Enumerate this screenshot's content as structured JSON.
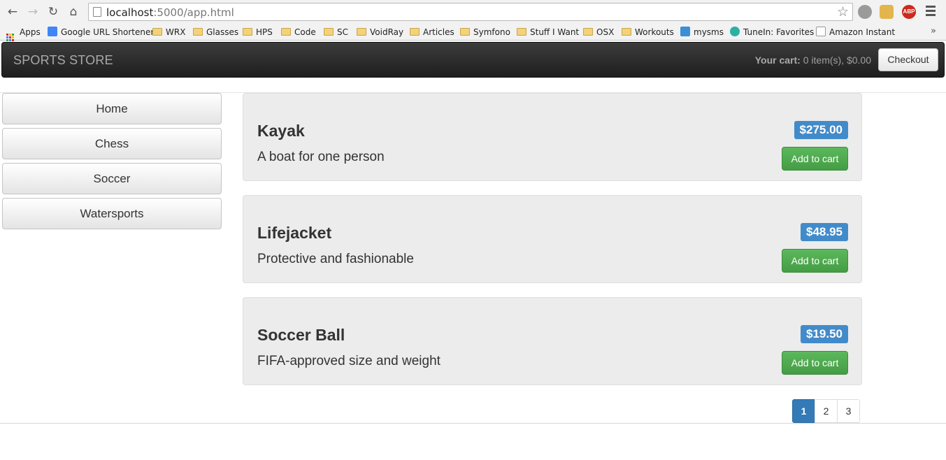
{
  "browser": {
    "url_host": "localhost",
    "url_rest": ":5000/app.html",
    "extensions": [
      "ABP"
    ]
  },
  "bookmarks": [
    {
      "label": "Apps",
      "icon": "apps-icon"
    },
    {
      "label": "Google URL Shortener",
      "icon": "google-icon"
    },
    {
      "label": "WRX",
      "icon": "folder-icon"
    },
    {
      "label": "Glasses",
      "icon": "folder-icon"
    },
    {
      "label": "HPS",
      "icon": "folder-icon"
    },
    {
      "label": "Code",
      "icon": "folder-icon"
    },
    {
      "label": "SC",
      "icon": "folder-icon"
    },
    {
      "label": "VoidRay",
      "icon": "folder-icon"
    },
    {
      "label": "Articles",
      "icon": "folder-icon"
    },
    {
      "label": "Symfono",
      "icon": "folder-icon"
    },
    {
      "label": "Stuff I Want",
      "icon": "folder-icon"
    },
    {
      "label": "OSX",
      "icon": "folder-icon"
    },
    {
      "label": "Workouts",
      "icon": "folder-icon"
    },
    {
      "label": "mysms",
      "icon": "mysms-icon"
    },
    {
      "label": "TuneIn: Favorites",
      "icon": "tunein-icon"
    },
    {
      "label": "Amazon Instant",
      "icon": "amazon-icon"
    }
  ],
  "navbar": {
    "brand": "SPORTS STORE",
    "cart_label": "Your cart:",
    "cart_value": "0 item(s), $0.00",
    "checkout": "Checkout"
  },
  "categories": [
    "Home",
    "Chess",
    "Soccer",
    "Watersports"
  ],
  "products": [
    {
      "name": "Kayak",
      "description": "A boat for one person",
      "price": "$275.00",
      "button": "Add to cart"
    },
    {
      "name": "Lifejacket",
      "description": "Protective and fashionable",
      "price": "$48.95",
      "button": "Add to cart"
    },
    {
      "name": "Soccer Ball",
      "description": "FIFA-approved size and weight",
      "price": "$19.50",
      "button": "Add to cart"
    }
  ],
  "pagination": {
    "pages": [
      "1",
      "2",
      "3"
    ],
    "active": "1"
  },
  "colors": {
    "price_badge": "#428bca",
    "add_button": "#5cb85c",
    "navbar": "#222222",
    "active_page": "#337ab7"
  }
}
